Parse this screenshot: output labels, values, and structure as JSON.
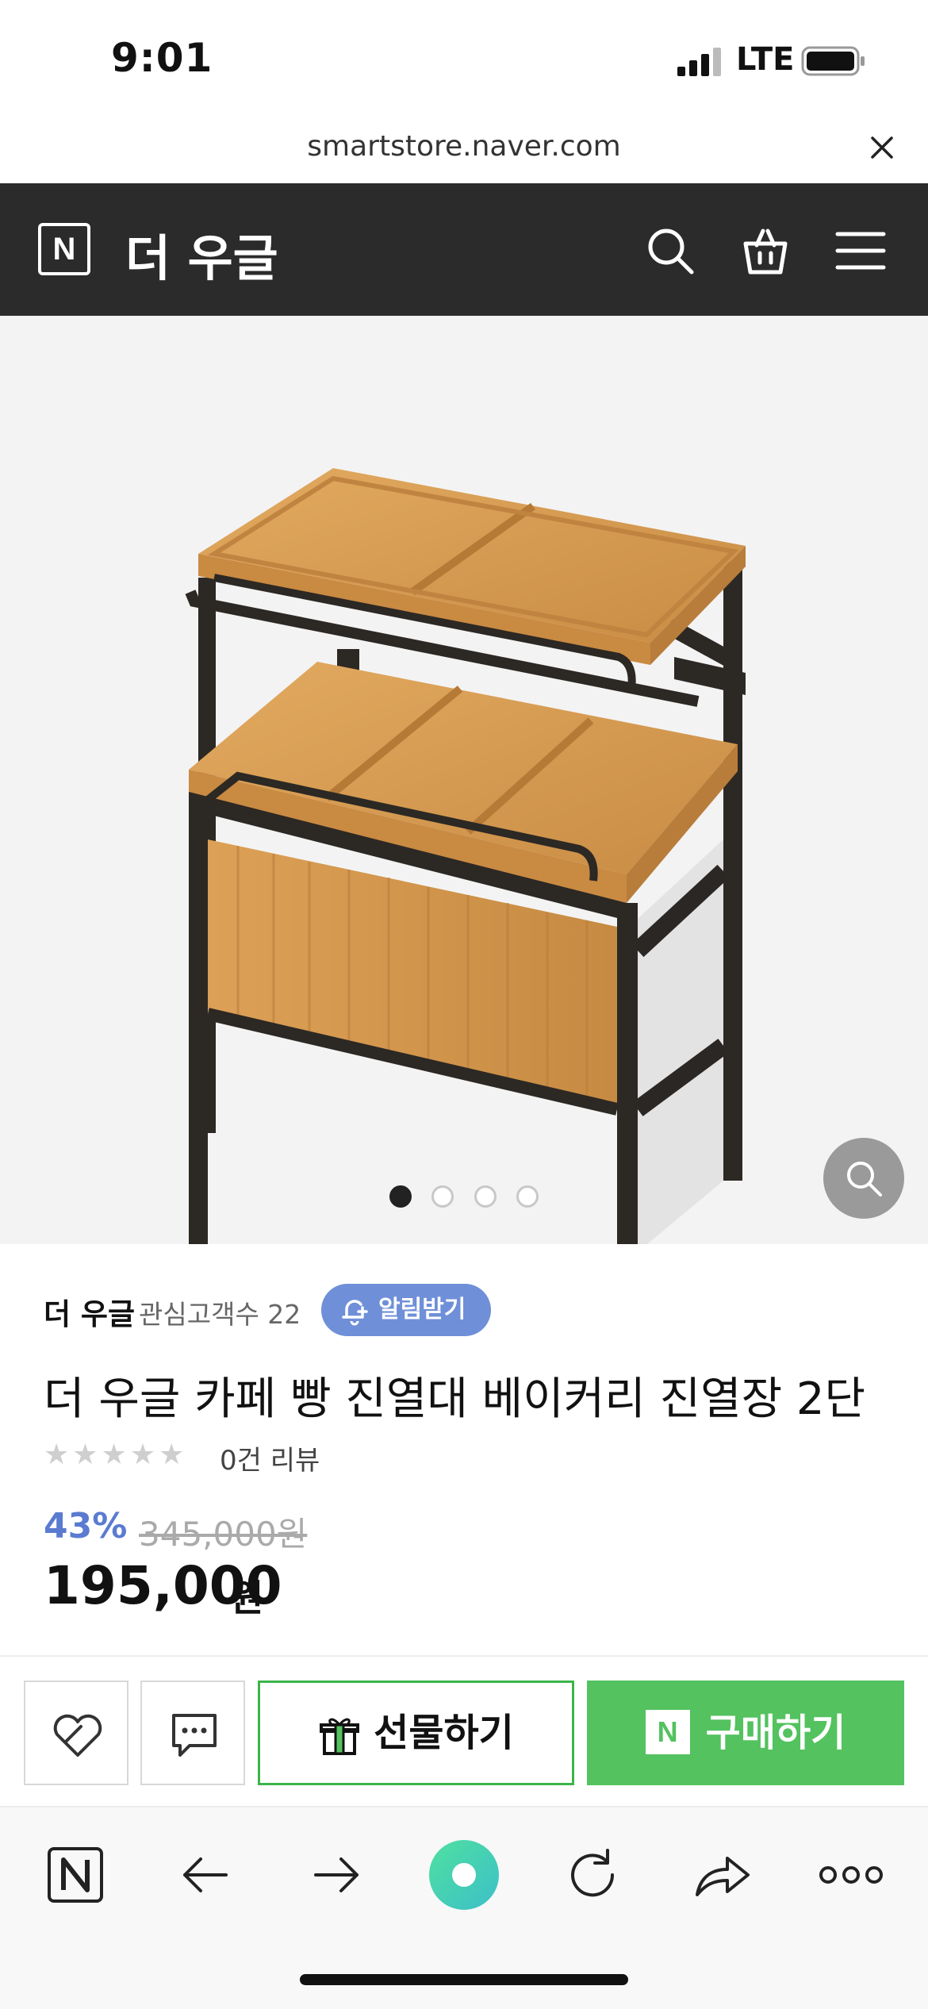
{
  "status_bar": {
    "time": "9:01",
    "network": "LTE"
  },
  "url_bar": {
    "url": "smartstore.naver.com"
  },
  "header": {
    "logo": "N",
    "store_name": "더 우글"
  },
  "gallery": {
    "page_count": 4,
    "active_page": 1
  },
  "product": {
    "seller_name": "더 우글",
    "followers": "관심고객수 22",
    "notify_label": "알림받기",
    "title": "더 우글 카페 빵 진열대 베이커리 진열장 2단",
    "stars": "★★★★★",
    "rating_stars": 0,
    "review_count": "0건 리뷰",
    "discount": "43%",
    "original_price": "345,000원",
    "price": "195,000",
    "price_unit": "원"
  },
  "actions": {
    "gift_label": "선물하기",
    "buy_logo": "N",
    "buy_label": "구매하기"
  },
  "colors": {
    "header_bg": "#2b2b2b",
    "accent_blue": "#6f8fd8",
    "buy_green": "#53c25f",
    "gift_border": "#3bb54a"
  },
  "icons": [
    "search-icon",
    "cart-icon",
    "menu-icon",
    "zoom-icon",
    "heart-icon",
    "chat-icon",
    "gift-icon",
    "back-icon",
    "forward-icon",
    "reload-icon",
    "share-icon",
    "more-icon"
  ]
}
